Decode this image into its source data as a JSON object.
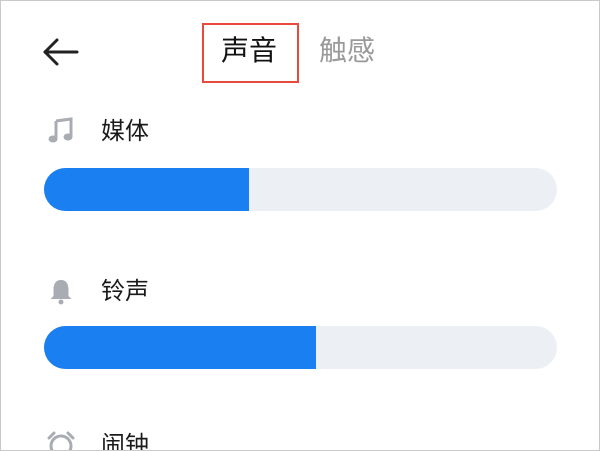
{
  "header": {
    "back_icon": "back-arrow-icon",
    "tabs": [
      {
        "label": "声音",
        "active": true
      },
      {
        "label": "触感",
        "active": false
      }
    ],
    "highlight_color": "#e84a3d"
  },
  "volume_rows": [
    {
      "label": "媒体",
      "icon": "music-note-icon",
      "level": 0.4
    },
    {
      "label": "铃声",
      "icon": "bell-icon",
      "level": 0.53
    },
    {
      "label": "闹钟",
      "icon": "alarm-clock-icon"
    }
  ],
  "colors": {
    "accent": "#1a7ff0",
    "track": "#eceff3",
    "icon": "#a9adb3"
  }
}
